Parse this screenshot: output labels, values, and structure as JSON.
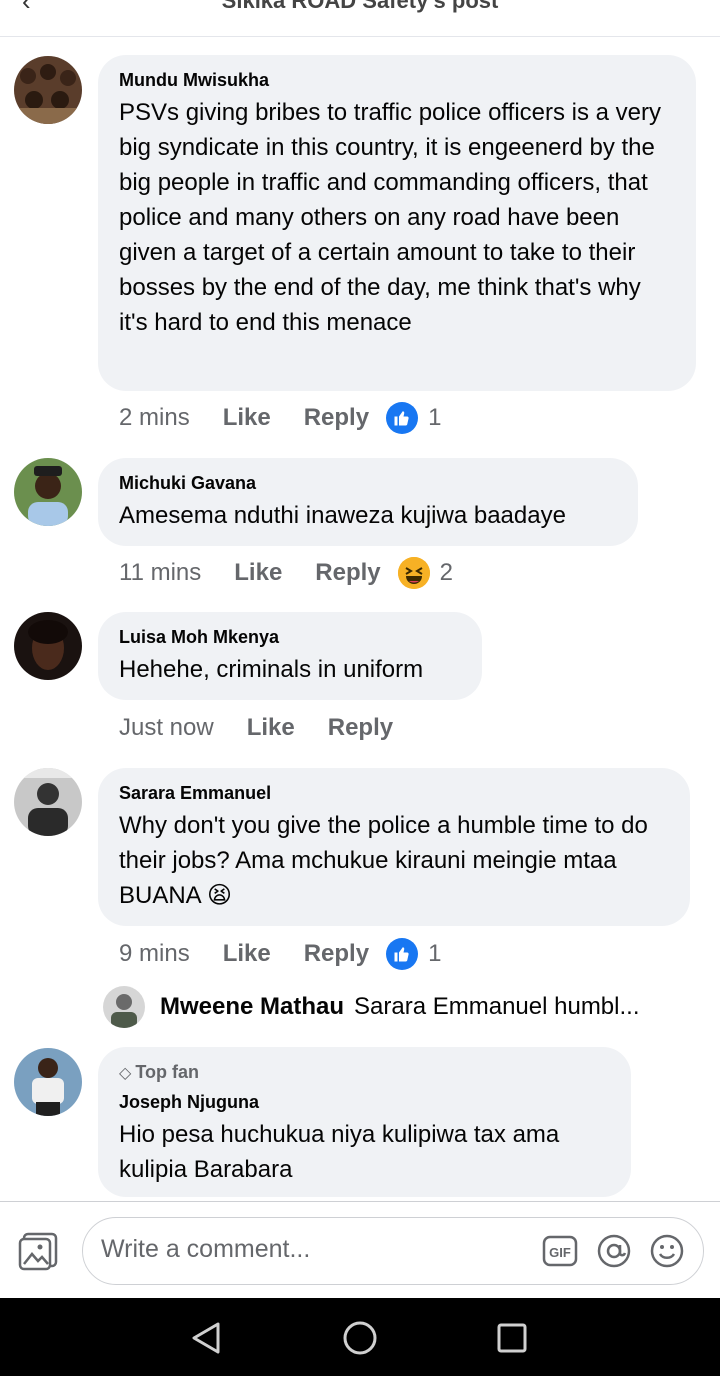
{
  "header": {
    "back_icon": "arrow-left-icon",
    "title": "Sikika ROAD Safety's post"
  },
  "comments": [
    {
      "name": "Mundu Mwisukha",
      "text": "PSVs giving bribes to traffic police officers is a very big syndicate in this country, it is engeenerd by the big people in traffic and commanding officers, that police and many others on any road have been given a target of a certain amount to take to their bosses by the end of the day, me think that's why it's hard to end this menace",
      "time": "2 mins",
      "like": "Like",
      "reply": "Reply",
      "reaction_icon": "like-reaction-icon",
      "reaction_count": "1"
    },
    {
      "name": "Michuki Gavana",
      "text": "Amesema nduthi inaweza kujiwa baadaye",
      "time": "11 mins",
      "like": "Like",
      "reply": "Reply",
      "reaction_icon": "haha-reaction-icon",
      "reaction_count": "2"
    },
    {
      "name": "Luisa Moh Mkenya",
      "text": "Hehehe, criminals in uniform",
      "time": "Just now",
      "like": "Like",
      "reply": "Reply"
    },
    {
      "name": "Sarara Emmanuel",
      "text": "Why don't you give the police a humble time to do their jobs? Ama mchukue kirauni meingie mtaa BUANA 😫",
      "time": "9 mins",
      "like": "Like",
      "reply": "Reply",
      "reaction_icon": "like-reaction-icon",
      "reaction_count": "1"
    },
    {
      "badge": "Top fan",
      "name": "Joseph Njuguna",
      "text": "Hio pesa huchukua niya kulipiwa tax ama kulipia Barabara"
    }
  ],
  "reply_preview": {
    "name": "Mweene Mathau",
    "text": "Sarara Emmanuel humbl..."
  },
  "composer": {
    "placeholder": "Write a comment...",
    "gif_label": "GIF"
  },
  "colors": {
    "like_blue": "#1877f2",
    "bubble_bg": "#f0f2f5",
    "meta_gray": "#65676b"
  }
}
